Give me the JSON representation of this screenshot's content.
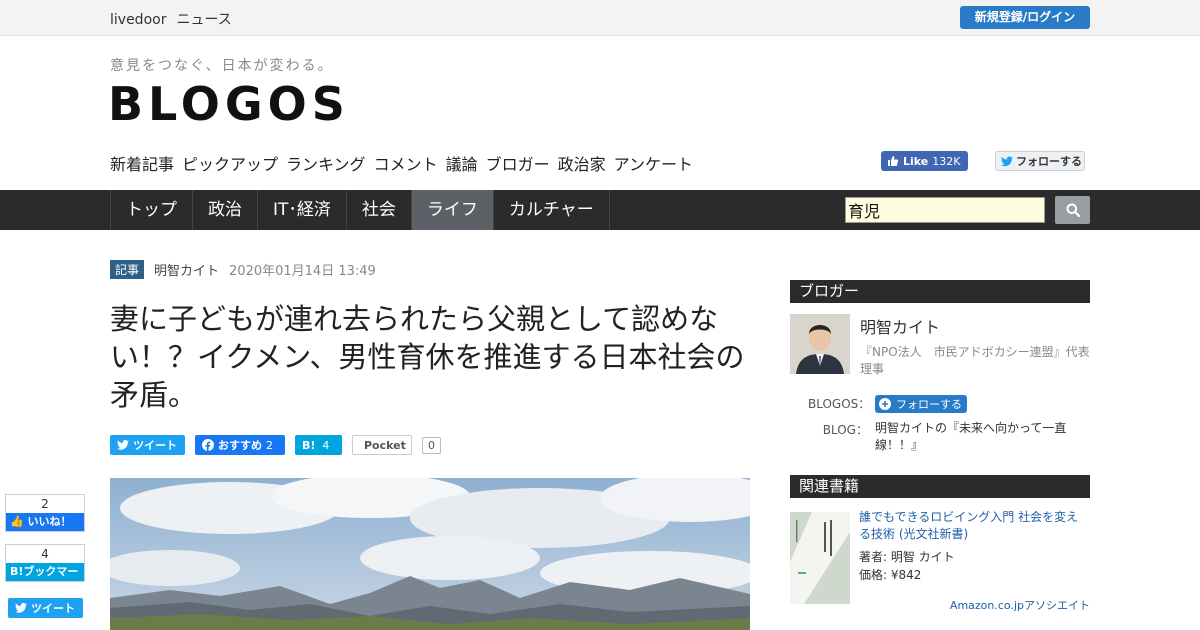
{
  "topbar": {
    "brand_1": "livedoor",
    "brand_2": "ニュース",
    "login": "新規登録/ログイン"
  },
  "site": {
    "tagline": "意見をつなぐ、日本が変わる。",
    "logo": "BLOGOS"
  },
  "subnav": [
    "新着記事",
    "ピックアップ",
    "ランキング",
    "コメント",
    "議論",
    "ブロガー",
    "政治家",
    "アンケート"
  ],
  "social": {
    "fb_like_label": "Like",
    "fb_like_count": "132K",
    "tw_follow": "フォローする"
  },
  "mainnav": {
    "tabs": [
      {
        "label": "トップ"
      },
      {
        "label": "政治"
      },
      {
        "label": "IT･経済"
      },
      {
        "label": "社会"
      },
      {
        "label": "ライフ",
        "active": true
      },
      {
        "label": "カルチャー"
      }
    ],
    "search_value": "育児"
  },
  "article": {
    "badge": "記事",
    "author": "明智カイト",
    "date": "2020年01月14日 13:49",
    "title": "妻に子どもが連れ去られたら父親として認めない！？イクメン、男性育休を推進する日本社会の矛盾。"
  },
  "share": {
    "tweet": "ツイート",
    "fb": "おすすめ",
    "fb_count": "2",
    "hatena": "B!",
    "hatena_count": "4",
    "pocket": "Pocket",
    "pocket_count": "0"
  },
  "float_share": {
    "like_count": "2",
    "like_label": "いいね！",
    "bookmark_count": "4",
    "bookmark_label": "B!ブックマーク",
    "tweet": "ツイート"
  },
  "sidebar": {
    "blogger_head": "ブロガー",
    "blogger_name": "明智カイト",
    "blogger_desc": "『NPO法人　市民アドボカシー連盟』代表理事",
    "blogos_label": "BLOGOS：",
    "follow_btn": "フォローする",
    "blog_label": "BLOG：",
    "blog_title": "明智カイトの『未来へ向かって一直線！！』",
    "books_head": "関連書籍",
    "book_title": "誰でもできるロビイング入門 社会を変える技術 (光文社新書)",
    "book_author": "著者: 明智 カイト",
    "book_price": "価格: ¥842",
    "amazon": "Amazon.co.jpアソシエイト"
  },
  "colors": {
    "accent_blue": "#2a7bc7",
    "nav_dark": "#2b2b2b",
    "active_tab": "#5d6167"
  }
}
